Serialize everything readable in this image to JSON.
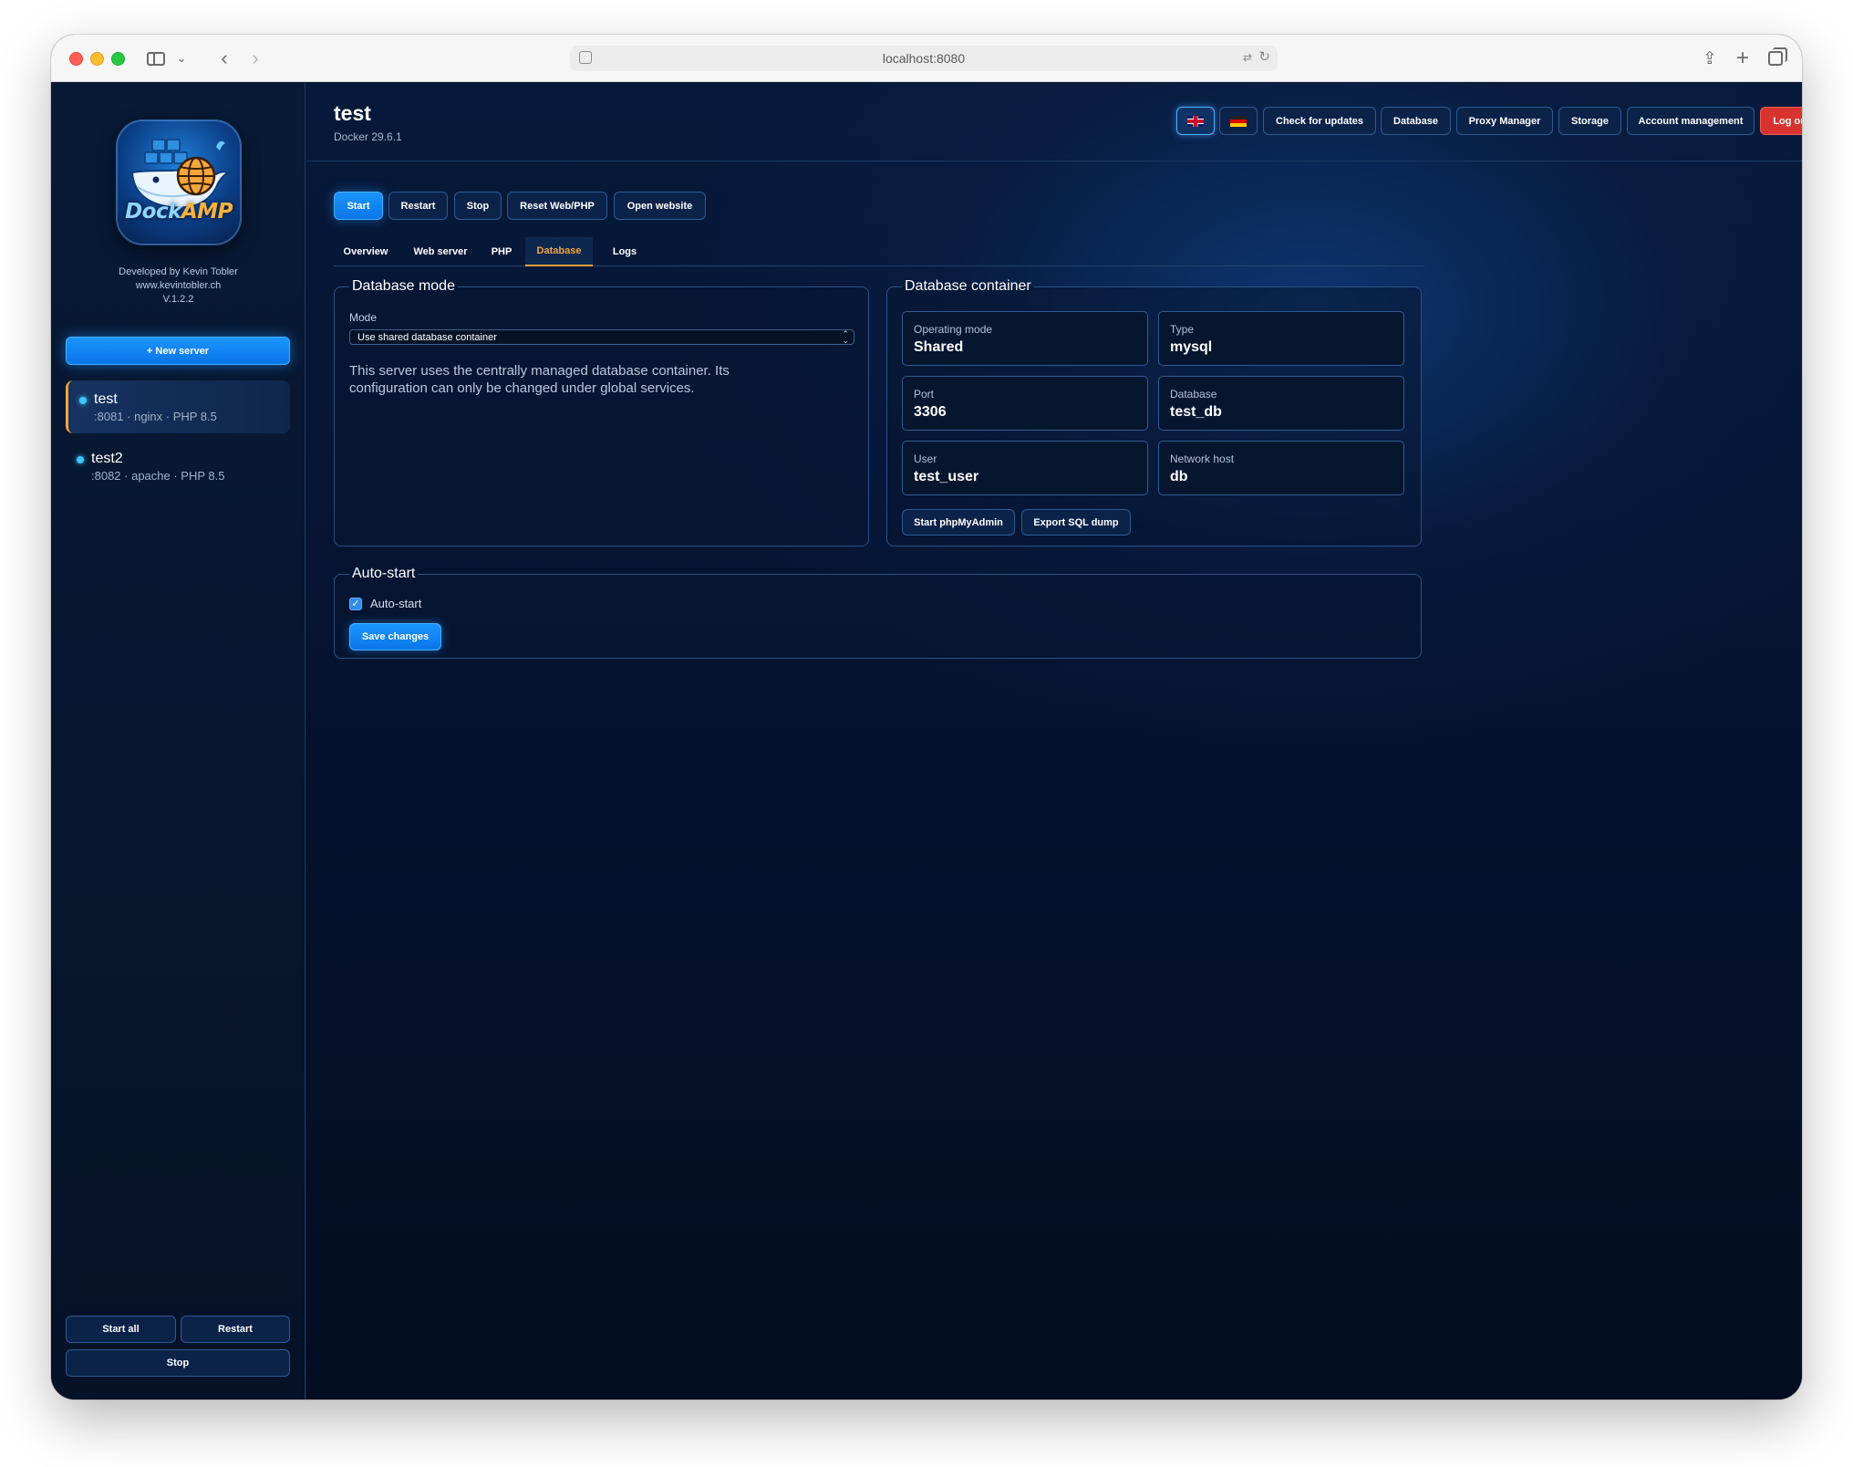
{
  "browser": {
    "url": "localhost:8080"
  },
  "sidebar": {
    "logo_text_main": "Dock",
    "logo_text_accent": "AMP",
    "developer": "Developed by Kevin Tobler",
    "website": "www.kevintobler.ch",
    "version": "V.1.2.2",
    "new_server_label": "+ New server",
    "servers": [
      {
        "name": "test",
        "meta": ":8081 · nginx · PHP 8.5",
        "active": true
      },
      {
        "name": "test2",
        "meta": ":8082 · apache · PHP 8.5",
        "active": false
      }
    ],
    "start_all_label": "Start all",
    "restart_label": "Restart",
    "stop_label": "Stop"
  },
  "header": {
    "title": "test",
    "docker_version": "Docker 29.6.1",
    "lang_en_icon": "flag-uk-icon",
    "lang_de_icon": "flag-de-icon",
    "check_updates_label": "Check for updates",
    "database_label": "Database",
    "proxy_manager_label": "Proxy Manager",
    "storage_label": "Storage",
    "account_label": "Account management",
    "logout_label": "Log out"
  },
  "actions": {
    "start_label": "Start",
    "restart_label": "Restart",
    "stop_label": "Stop",
    "reset_label": "Reset Web/PHP",
    "open_label": "Open website"
  },
  "tabs": [
    {
      "label": "Overview",
      "active": false
    },
    {
      "label": "Web server",
      "active": false
    },
    {
      "label": "PHP",
      "active": false
    },
    {
      "label": "Database",
      "active": true
    },
    {
      "label": "Logs",
      "active": false
    }
  ],
  "db_mode": {
    "legend": "Database mode",
    "mode_label": "Mode",
    "mode_value": "Use shared database container",
    "info_line1": "This server uses the centrally managed database container. Its",
    "info_line2": "configuration can only be changed under global services."
  },
  "db_container": {
    "legend": "Database container",
    "stats": [
      {
        "key": "Operating mode",
        "value": "Shared"
      },
      {
        "key": "Type",
        "value": "mysql"
      },
      {
        "key": "Port",
        "value": "3306"
      },
      {
        "key": "Database",
        "value": "test_db"
      },
      {
        "key": "User",
        "value": "test_user"
      },
      {
        "key": "Network host",
        "value": "db"
      }
    ],
    "phpmyadmin_label": "Start phpMyAdmin",
    "export_label": "Export SQL dump"
  },
  "autostart": {
    "legend": "Auto-start",
    "checkbox_label": "Auto-start",
    "checked": true,
    "save_label": "Save changes"
  },
  "colors": {
    "accent": "#1a8cff",
    "tab_active": "#f2a33a",
    "logout": "#d8332f",
    "status_dot": "#3ec5ff"
  }
}
